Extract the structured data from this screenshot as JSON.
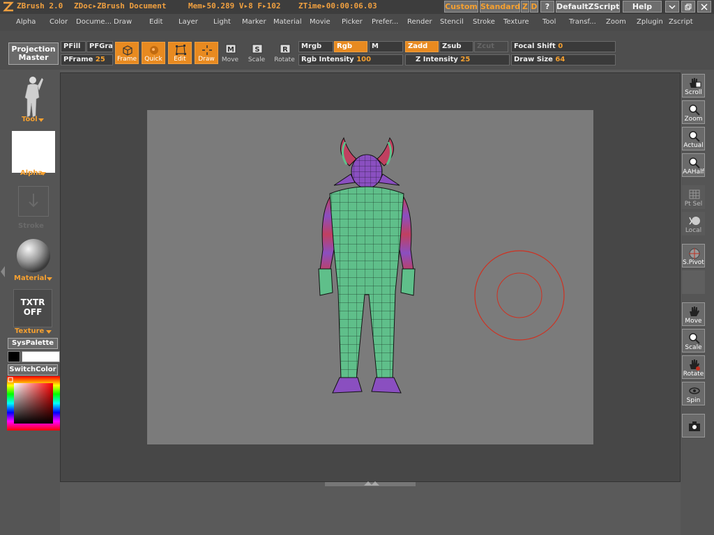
{
  "titlebar": {
    "app": "ZBrush 2.0",
    "doc": "ZDoc▸ZBrush Document",
    "mem": "Mem▸50.289 V▸8 F▸102",
    "ztime": "ZTime▸00:00:06.03",
    "custom": "Custom",
    "standard": "Standard",
    "z": "Z",
    "d": "D",
    "q": "?",
    "zscript": "DefaultZScript",
    "help": "Help"
  },
  "menu": [
    "Alpha",
    "Color",
    "Docume...",
    "Draw",
    "Edit",
    "Layer",
    "Light",
    "Marker",
    "Material",
    "Movie",
    "Picker",
    "Prefer...",
    "Render",
    "Stencil",
    "Stroke",
    "Texture",
    "Tool",
    "Transf...",
    "Zoom",
    "Zplugin",
    "Zscript"
  ],
  "toolbar": {
    "projection_master": "Projection Master",
    "pfill": "PFill",
    "pfgra": "PFGra",
    "pframe": "PFrame",
    "pframe_val": "25",
    "frame": "Frame",
    "quick": "Quick",
    "edit": "Edit",
    "draw": "Draw",
    "move": "Move",
    "scale": "Scale",
    "rotate": "Rotate",
    "mrgb": "Mrgb",
    "rgb": "Rgb",
    "m": "M",
    "zadd": "Zadd",
    "zsub": "Zsub",
    "zcut": "Zcut",
    "rgb_intensity": "Rgb Intensity",
    "rgb_intensity_val": "100",
    "z_intensity": "Z Intensity",
    "z_intensity_val": "25",
    "focal_shift": "Focal Shift",
    "focal_shift_val": "0",
    "draw_size": "Draw Size",
    "draw_size_val": "64",
    "icon_m": "M",
    "icon_s": "S",
    "icon_r": "R"
  },
  "leftpanel": {
    "tool": "Tool",
    "alpha": "Alpha",
    "stroke": "Stroke",
    "material": "Material",
    "txtr": "TXTR OFF",
    "texture": "Texture",
    "syspalette": "SysPalette",
    "switchcolor": "SwitchColor"
  },
  "rightpanel": {
    "scroll": "Scroll",
    "zoom": "Zoom",
    "actual": "Actual",
    "aahalf": "AAHalf",
    "ptsel": "Pt Sel",
    "local": "Local",
    "spivot": "S.Pivot",
    "move": "Move",
    "scale": "Scale",
    "rotate": "Rotate",
    "spin": "Spin"
  },
  "colors": {
    "accent": "#e88a20",
    "brush_circle": "#d03020",
    "mesh_body": "#5fbf8a",
    "mesh_head": "#8a4fc0"
  }
}
